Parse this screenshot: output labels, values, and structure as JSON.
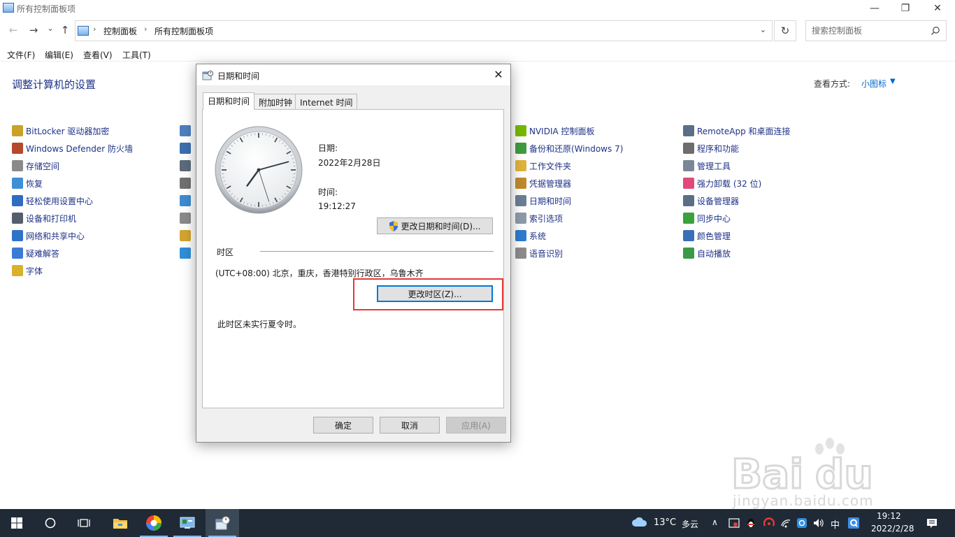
{
  "window": {
    "title": "所有控制面板项",
    "min_glyph": "—",
    "max_glyph": "❐",
    "close_glyph": "✕"
  },
  "nav": {
    "back_glyph": "←",
    "forward_glyph": "→",
    "history_glyph": "⌄",
    "up_glyph": "↑",
    "breadcrumb": [
      "控制面板",
      "所有控制面板项"
    ],
    "breadcrumb_sep": "›",
    "dropdown_glyph": "⌄",
    "refresh_glyph": "↻",
    "search_placeholder": "搜索控制面板"
  },
  "menu": [
    "文件(F)",
    "编辑(E)",
    "查看(V)",
    "工具(T)"
  ],
  "content": {
    "heading": "调整计算机的设置",
    "view_by_label": "查看方式:",
    "view_by_value": "小图标",
    "view_by_arrow": "▼"
  },
  "items": {
    "col1": [
      {
        "label": "BitLocker 驱动器加密",
        "color": "#c9a227"
      },
      {
        "label": "Windows Defender 防火墙",
        "color": "#b5482d"
      },
      {
        "label": "存储空间",
        "color": "#8a8a8a"
      },
      {
        "label": "恢复",
        "color": "#3d8fd6"
      },
      {
        "label": "轻松使用设置中心",
        "color": "#2f6cc2"
      },
      {
        "label": "设备和打印机",
        "color": "#555f6b"
      },
      {
        "label": "网络和共享中心",
        "color": "#2f73c9"
      },
      {
        "label": "疑难解答",
        "color": "#3a7bd5"
      },
      {
        "label": "字体",
        "color": "#d9b12b"
      }
    ],
    "col3": [
      {
        "label": "NVIDIA 控制面板",
        "color": "#76b900"
      },
      {
        "label": "备份和还原(Windows 7)",
        "color": "#3f9b42"
      },
      {
        "label": "工作文件夹",
        "color": "#e0b33c"
      },
      {
        "label": "凭据管理器",
        "color": "#c08a2d"
      },
      {
        "label": "日期和时间",
        "color": "#6b7f95"
      },
      {
        "label": "索引选项",
        "color": "#8e9aa8"
      },
      {
        "label": "系统",
        "color": "#2e7bcf"
      },
      {
        "label": "语音识别",
        "color": "#8c8c8c"
      }
    ],
    "col4": [
      {
        "label": "RemoteApp 和桌面连接",
        "color": "#5a6f86"
      },
      {
        "label": "程序和功能",
        "color": "#6d6d6d"
      },
      {
        "label": "管理工具",
        "color": "#7a8796"
      },
      {
        "label": "强力卸载 (32 位)",
        "color": "#e04a7a"
      },
      {
        "label": "设备管理器",
        "color": "#5a6f86"
      },
      {
        "label": "同步中心",
        "color": "#3aa13d"
      },
      {
        "label": "颜色管理",
        "color": "#3770b8"
      },
      {
        "label": "自动播放",
        "color": "#3b9a47"
      }
    ],
    "col2_colors": [
      "#4f7fbf",
      "#3c6fae",
      "#5c6b7a",
      "#707070",
      "#3d8bd0",
      "#8a8a8a",
      "#d2a52f",
      "#2f8fd6"
    ]
  },
  "dialog": {
    "title": "日期和时间",
    "close_glyph": "✕",
    "tabs": [
      "日期和时间",
      "附加时钟",
      "Internet 时间"
    ],
    "date_label": "日期:",
    "date_value": "2022年2月28日",
    "time_label": "时间:",
    "time_value": "19:12:27",
    "change_datetime_button": "更改日期和时间(D)...",
    "timezone_group_label": "时区",
    "timezone_value": "(UTC+08:00) 北京，重庆，香港特别行政区，乌鲁木齐",
    "change_timezone_button": "更改时区(Z)...",
    "dst_note": "此时区未实行夏令时。",
    "ok_button": "确定",
    "cancel_button": "取消",
    "apply_button": "应用(A)",
    "clock": {
      "hour": 19,
      "minute": 12,
      "second": 27
    }
  },
  "taskbar": {
    "weather_temp": "13°C",
    "weather_desc": "多云",
    "tray_chevron": "∧",
    "ime": "中",
    "time": "19:12",
    "date": "2022/2/28"
  },
  "watermark": {
    "text": "jingyan.baidu.com"
  }
}
